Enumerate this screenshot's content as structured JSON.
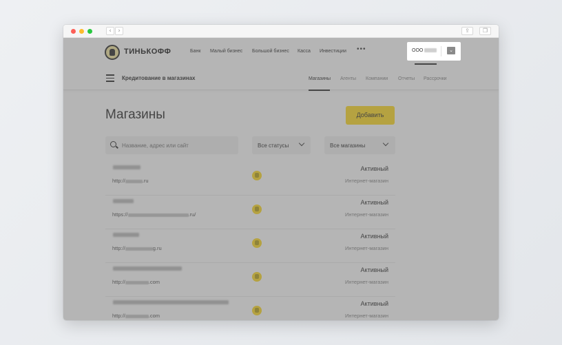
{
  "header": {
    "brand": "ТИНЬКОФФ",
    "nav": [
      "Банк",
      "Малый бизнес",
      "Большой бизнес",
      "Касса",
      "Инвестиции"
    ],
    "more": "•••",
    "company_prefix": "ООО"
  },
  "subheader": {
    "title": "Кредитование в магазинах",
    "tabs": [
      "Магазины",
      "Агенты",
      "Компании",
      "Отчеты",
      "Рассрочки"
    ],
    "active_tab": "Магазины"
  },
  "page": {
    "title": "Магазины",
    "add_button": "Добавить",
    "search_placeholder": "Название, адрес или сайт",
    "status_filter": "Все статусы",
    "shops_filter": "Все магазины"
  },
  "stores": [
    {
      "url_prefix": "http://",
      "url_suffix": ".ru",
      "status": "Активный",
      "type": "Интернет-магазин"
    },
    {
      "url_prefix": "https://",
      "url_suffix": ".ru/",
      "status": "Активный",
      "type": "Интернет-магазин"
    },
    {
      "url_prefix": "http://",
      "url_suffix": "g.ru",
      "status": "Активный",
      "type": "Интернет-магазин"
    },
    {
      "url_prefix": "http://",
      "url_suffix": ".com",
      "status": "Активный",
      "type": "Интернет-магазин"
    },
    {
      "url_prefix": "http://",
      "url_suffix": ".com",
      "status": "Активный",
      "type": "Интернет-магазин"
    }
  ],
  "colors": {
    "accent": "#ffdd2d",
    "overlay": "rgba(90,90,90,0.45)",
    "text": "#333333"
  }
}
